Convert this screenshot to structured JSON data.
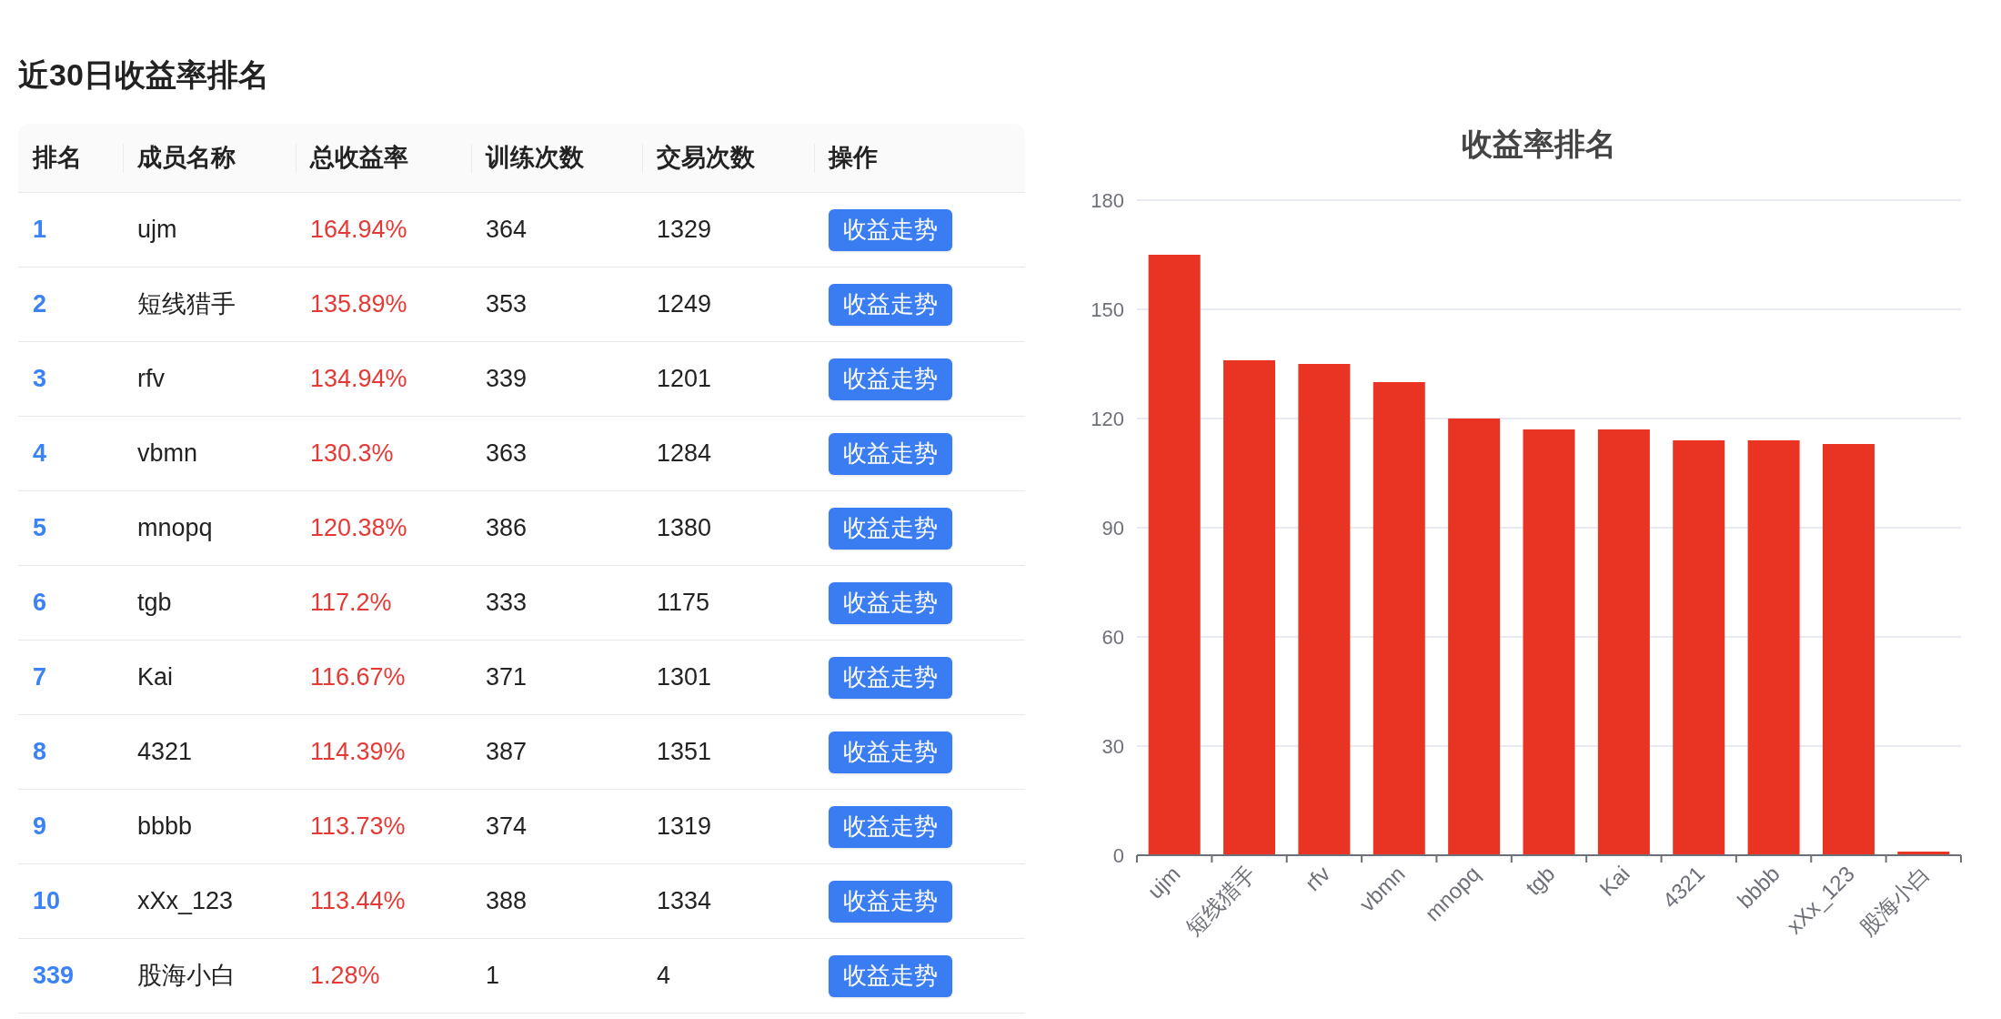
{
  "title": "近30日收益率排名",
  "table": {
    "columns": [
      "排名",
      "成员名称",
      "总收益率",
      "训练次数",
      "交易次数",
      "操作"
    ],
    "rows": [
      {
        "rank": "1",
        "name": "ujm",
        "return": "164.94%",
        "training": "364",
        "trades": "1329",
        "action": "收益走势"
      },
      {
        "rank": "2",
        "name": "短线猎手",
        "return": "135.89%",
        "training": "353",
        "trades": "1249",
        "action": "收益走势"
      },
      {
        "rank": "3",
        "name": "rfv",
        "return": "134.94%",
        "training": "339",
        "trades": "1201",
        "action": "收益走势"
      },
      {
        "rank": "4",
        "name": "vbmn",
        "return": "130.3%",
        "training": "363",
        "trades": "1284",
        "action": "收益走势"
      },
      {
        "rank": "5",
        "name": "mnopq",
        "return": "120.38%",
        "training": "386",
        "trades": "1380",
        "action": "收益走势"
      },
      {
        "rank": "6",
        "name": "tgb",
        "return": "117.2%",
        "training": "333",
        "trades": "1175",
        "action": "收益走势"
      },
      {
        "rank": "7",
        "name": "Kai",
        "return": "116.67%",
        "training": "371",
        "trades": "1301",
        "action": "收益走势"
      },
      {
        "rank": "8",
        "name": "4321",
        "return": "114.39%",
        "training": "387",
        "trades": "1351",
        "action": "收益走势"
      },
      {
        "rank": "9",
        "name": "bbbb",
        "return": "113.73%",
        "training": "374",
        "trades": "1319",
        "action": "收益走势"
      },
      {
        "rank": "10",
        "name": "xXx_123",
        "return": "113.44%",
        "training": "388",
        "trades": "1334",
        "action": "收益走势"
      },
      {
        "rank": "339",
        "name": "股海小白",
        "return": "1.28%",
        "training": "1",
        "trades": "4",
        "action": "收益走势"
      }
    ]
  },
  "chart": {
    "chart_data": {
      "type": "bar",
      "title": "收益率排名",
      "categories": [
        "ujm",
        "短线猎手",
        "rfv",
        "vbmn",
        "mnopq",
        "tgb",
        "Kai",
        "4321",
        "bbbb",
        "xXx_123",
        "股海小白"
      ],
      "series": [
        {
          "color": "#e93323",
          "values": [
            165,
            136,
            135,
            130,
            120,
            117,
            117,
            114,
            114,
            113,
            1
          ]
        }
      ],
      "ylim": [
        0,
        180
      ],
      "grid": true,
      "yticks": [
        0,
        30,
        60,
        90,
        120,
        150,
        180
      ]
    }
  }
}
